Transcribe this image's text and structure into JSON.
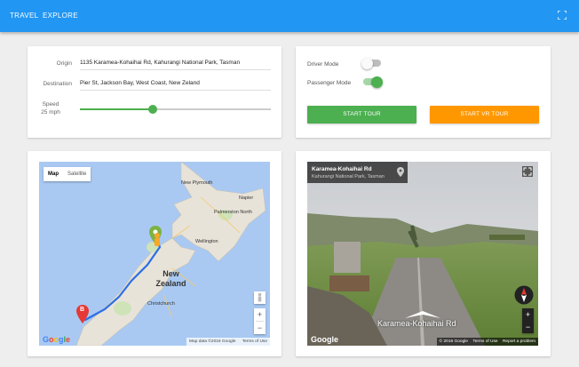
{
  "nav": {
    "travel": "TRAVEL",
    "explore": "EXPLORE"
  },
  "route": {
    "origin_label": "Origin",
    "origin_value": "1135 Karamea-Kohaihai Rd, Kahurangi National Park, Tasman",
    "destination_label": "Destination",
    "destination_value": "Pier St, Jackson Bay, West Coast, New Zeland",
    "speed_label": "Speed",
    "speed_value": "25 mph",
    "speed_level_fraction": 0.38
  },
  "modes": {
    "driver_label": "Driver Mode",
    "driver_on": false,
    "passenger_label": "Passenger Mode",
    "passenger_on": true
  },
  "buttons": {
    "start_tour": "START TOUR",
    "start_vr_tour": "START VR TOUR"
  },
  "map": {
    "tab_map": "Map",
    "tab_satellite": "Satellite",
    "zoom_in": "+",
    "zoom_out": "−",
    "region_label": "New Zealand",
    "marker_b": "B",
    "cities": {
      "new_plymouth": "New Plymouth",
      "wellington": "Wellington",
      "christchurch": "Christchurch",
      "napier": "Napier",
      "palmerston_north": "Palmerston North"
    },
    "google": "Google",
    "map_data": "Map data ©2016 Google",
    "terms": "Terms of Use"
  },
  "streetview": {
    "road_title": "Karamea-Kohaihai Rd",
    "road_subtitle": "Kahurangi National Park, Tasman",
    "road_overlay": "Karamea-Kohaihai Rd",
    "zoom_in": "+",
    "zoom_out": "−",
    "google": "Google",
    "copyright": "© 2016 Google",
    "terms": "Terms of Use",
    "report": "Report a problem"
  },
  "colors": {
    "primary": "#2196f3",
    "green": "#4caf50",
    "orange": "#ff9800"
  }
}
